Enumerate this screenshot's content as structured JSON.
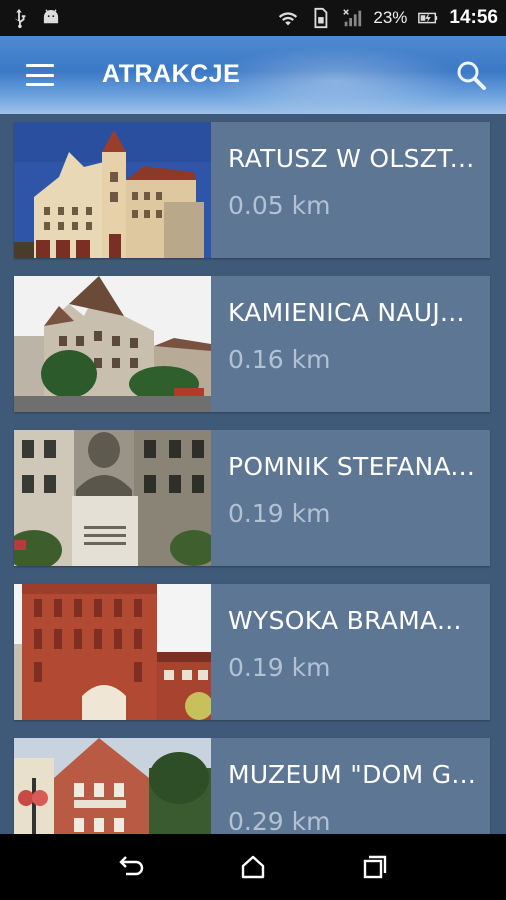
{
  "status_bar": {
    "battery_percent": "23%",
    "time": "14:56"
  },
  "app_bar": {
    "title": "ATRAKCJE",
    "menu_icon": "hamburger-menu-icon",
    "search_icon": "search-icon"
  },
  "attractions": [
    {
      "title": "RATUSZ W OLSZT...",
      "distance": "0.05 km"
    },
    {
      "title": "KAMIENICA NAUJ...",
      "distance": "0.16 km"
    },
    {
      "title": "POMNIK STEFANA...",
      "distance": "0.19 km"
    },
    {
      "title": "WYSOKA BRAMA...",
      "distance": "0.19 km"
    },
    {
      "title": "MUZEUM \"DOM G...",
      "distance": "0.29 km"
    }
  ],
  "nav_bar": {
    "back_icon": "back-icon",
    "home_icon": "home-icon",
    "recents_icon": "recents-icon"
  },
  "colors": {
    "background": "#3f5a78",
    "card": "#5c7694",
    "app_bar": "#3b78c6",
    "distance_text": "#b3c2d3"
  }
}
